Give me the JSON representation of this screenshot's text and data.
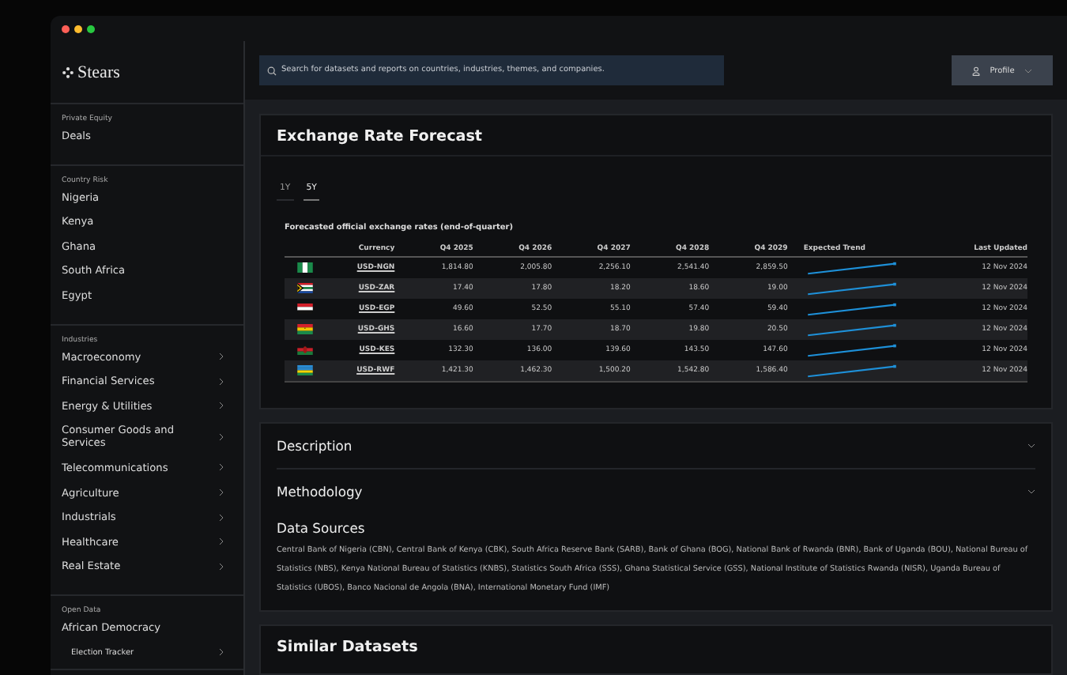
{
  "window": {
    "logo": "Stears"
  },
  "sidebar": {
    "sections": [
      {
        "label": "Private Equity",
        "items": [
          {
            "label": "Deals",
            "expandable": false
          }
        ]
      },
      {
        "label": "Country Risk",
        "items": [
          {
            "label": "Nigeria",
            "expandable": false
          },
          {
            "label": "Kenya",
            "expandable": false
          },
          {
            "label": "Ghana",
            "expandable": false
          },
          {
            "label": "South Africa",
            "expandable": false
          },
          {
            "label": "Egypt",
            "expandable": false
          }
        ]
      },
      {
        "label": "Industries",
        "items": [
          {
            "label": "Macroeconomy",
            "expandable": true
          },
          {
            "label": "Financial Services",
            "expandable": true
          },
          {
            "label": "Energy & Utilities",
            "expandable": true
          },
          {
            "label": "Consumer Goods and Services",
            "expandable": true
          },
          {
            "label": "Telecommunications",
            "expandable": true
          },
          {
            "label": "Agriculture",
            "expandable": true
          },
          {
            "label": "Industrials",
            "expandable": true
          },
          {
            "label": "Healthcare",
            "expandable": true
          },
          {
            "label": "Real Estate",
            "expandable": true
          }
        ]
      },
      {
        "label": "Open Data",
        "items": [
          {
            "label": "African Democracy",
            "expandable": false,
            "children": [
              {
                "label": "Election Tracker",
                "expandable": true
              }
            ]
          }
        ]
      }
    ]
  },
  "search": {
    "placeholder": "Search for datasets and reports on countries, industries, themes, and companies."
  },
  "profile_button": {
    "label": "Profile"
  },
  "forecast": {
    "title": "Exchange Rate Forecast",
    "tabs": [
      {
        "label": "1Y",
        "selected": false
      },
      {
        "label": "5Y",
        "selected": true
      }
    ],
    "caption": "Forecasted official exchange rates (end-of-quarter)",
    "columns": [
      "Currency",
      "Q4 2025",
      "Q4 2026",
      "Q4 2027",
      "Q4 2028",
      "Q4 2029",
      "Expected Trend",
      "Last Updated"
    ],
    "rows": [
      {
        "kind": "nigeria",
        "currency": "USD-NGN",
        "values": [
          "1,814.80",
          "2,005.80",
          "2,256.10",
          "2,541.40",
          "2,859.50"
        ],
        "updated": "12 Nov 2024"
      },
      {
        "kind": "southafrica",
        "currency": "USD-ZAR",
        "values": [
          "17.40",
          "17.80",
          "18.20",
          "18.60",
          "19.00"
        ],
        "updated": "12 Nov 2024"
      },
      {
        "kind": "egypt",
        "currency": "USD-EGP",
        "values": [
          "49.60",
          "52.50",
          "55.10",
          "57.40",
          "59.40"
        ],
        "updated": "12 Nov 2024"
      },
      {
        "kind": "ghana",
        "currency": "USD-GHS",
        "values": [
          "16.60",
          "17.70",
          "18.70",
          "19.80",
          "20.50"
        ],
        "updated": "12 Nov 2024"
      },
      {
        "kind": "kenya",
        "currency": "USD-KES",
        "values": [
          "132.30",
          "136.00",
          "139.60",
          "143.50",
          "147.60"
        ],
        "updated": "12 Nov 2024"
      },
      {
        "kind": "rwanda",
        "currency": "USD-RWF",
        "values": [
          "1,421.30",
          "1,462.30",
          "1,500.20",
          "1,542.80",
          "1,586.40"
        ],
        "updated": "12 Nov 2024"
      }
    ]
  },
  "details": {
    "sections": [
      {
        "title": "Description",
        "expanded": false
      },
      {
        "title": "Methodology",
        "expanded": false
      }
    ],
    "sources_title": "Data Sources",
    "sources": "Central Bank of Nigeria (CBN), Central Bank of Kenya (CBK), South Africa Reserve Bank (SARB), Bank of Ghana (BOG), National Bank of Rwanda (BNR), Bank of Uganda (BOU), National Bureau of Statistics (NBS), Kenya National Bureau of Statistics (KNBS), Statistics South Africa (SSS), Ghana Statistical Service (GSS), National Institute of Statistics Rwanda (NISR), Uganda Bureau of Statistics (UBOS), Banco Nacional de Angola (BNA), International Monetary Fund (IMF)"
  },
  "similar": {
    "title": "Similar Datasets"
  }
}
